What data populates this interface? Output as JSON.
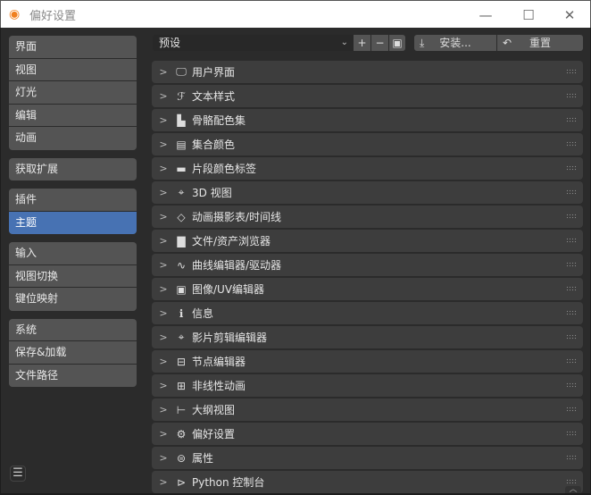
{
  "window": {
    "title": "偏好设置",
    "minimize": "—",
    "maximize": "☐",
    "close": "✕"
  },
  "sidebar": {
    "groups": [
      {
        "items": [
          {
            "label": "界面"
          },
          {
            "label": "视图"
          },
          {
            "label": "灯光"
          },
          {
            "label": "编辑"
          },
          {
            "label": "动画"
          }
        ]
      },
      {
        "items": [
          {
            "label": "获取扩展"
          }
        ]
      },
      {
        "items": [
          {
            "label": "插件"
          },
          {
            "label": "主题",
            "selected": true
          }
        ]
      },
      {
        "items": [
          {
            "label": "输入"
          },
          {
            "label": "视图切换"
          },
          {
            "label": "键位映射"
          }
        ]
      },
      {
        "items": [
          {
            "label": "系统"
          },
          {
            "label": "保存&加载"
          },
          {
            "label": "文件路径"
          }
        ]
      }
    ],
    "menu_icon": "☰"
  },
  "toolbar": {
    "preset": "预设",
    "chevron": "⌄",
    "add": "+",
    "remove": "−",
    "save_icon": "▣",
    "install_icon": "⤓",
    "install": "安装...",
    "reset_icon": "↶",
    "reset": "重置"
  },
  "panels": [
    {
      "label": "用户界面",
      "icon": "🖵"
    },
    {
      "label": "文本样式",
      "icon": "ℱ"
    },
    {
      "label": "骨骼配色集",
      "icon": "▙"
    },
    {
      "label": "集合颜色",
      "icon": "▤"
    },
    {
      "label": "片段颜色标签",
      "icon": "▬"
    },
    {
      "label": "3D 视图",
      "icon": "⌖"
    },
    {
      "label": "动画摄影表/时间线",
      "icon": "◇"
    },
    {
      "label": "文件/资产浏览器",
      "icon": "▇"
    },
    {
      "label": "曲线编辑器/驱动器",
      "icon": "∿"
    },
    {
      "label": "图像/UV编辑器",
      "icon": "▣"
    },
    {
      "label": "信息",
      "icon": "ℹ"
    },
    {
      "label": "影片剪辑编辑器",
      "icon": "⌖"
    },
    {
      "label": "节点编辑器",
      "icon": "⊟"
    },
    {
      "label": "非线性动画",
      "icon": "⊞"
    },
    {
      "label": "大纲视图",
      "icon": "⊢"
    },
    {
      "label": "偏好设置",
      "icon": "⚙"
    },
    {
      "label": "属性",
      "icon": "⊜"
    },
    {
      "label": "Python 控制台",
      "icon": "⊳"
    }
  ],
  "colors": {
    "accent": "#4772b3",
    "panel": "#3d3d3d",
    "background": "#2b2b2b"
  }
}
